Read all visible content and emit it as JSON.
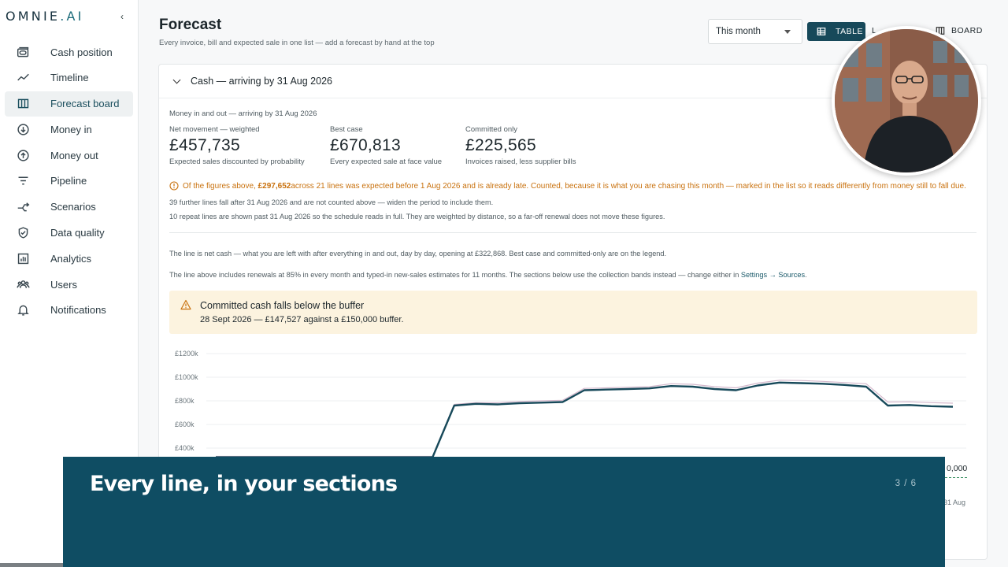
{
  "brand": {
    "name": "OMNIE",
    "dot": ".",
    "suffix": "AI"
  },
  "sidebar": {
    "collapse_glyph": "‹",
    "items": [
      {
        "label": "Cash position",
        "icon": "wallet-icon"
      },
      {
        "label": "Timeline",
        "icon": "trend-line-icon"
      },
      {
        "label": "Forecast board",
        "icon": "columns-icon",
        "active": true
      },
      {
        "label": "Money in",
        "icon": "arrow-down-circle-icon"
      },
      {
        "label": "Money out",
        "icon": "arrow-up-circle-icon"
      },
      {
        "label": "Pipeline",
        "icon": "filter-icon"
      },
      {
        "label": "Scenarios",
        "icon": "branch-arrows-icon"
      },
      {
        "label": "Data quality",
        "icon": "shield-check-icon"
      },
      {
        "label": "Analytics",
        "icon": "bar-chart-icon"
      },
      {
        "label": "Users",
        "icon": "users-icon"
      },
      {
        "label": "Notifications",
        "icon": "bell-icon"
      }
    ]
  },
  "header": {
    "title": "Forecast",
    "subtitle": "Every invoice, bill and expected sale in one list — add a forecast by hand at the top",
    "period": "This month",
    "views": {
      "table": "TABLE",
      "list": "L",
      "board": "BOARD"
    }
  },
  "section": {
    "title": "Cash — arriving by 31 Aug 2026",
    "label": "Money in and out — arriving by 31 Aug 2026",
    "metrics": [
      {
        "label": "Net movement — weighted",
        "value": "£457,735",
        "sub": "Expected sales discounted by probability"
      },
      {
        "label": "Best case",
        "value": "£670,813",
        "sub": "Every expected sale at face value"
      },
      {
        "label": "Committed only",
        "value": "£225,565",
        "sub": "Invoices raised, less supplier bills"
      }
    ],
    "late": {
      "prefix": "Of the figures above, ",
      "amount": "£297,652",
      "suffix": " across 21 lines was expected before 1 Aug 2026 and is already late. Counted, because it is what you are chasing this month — marked in the list so it reads differently from money still to fall due."
    },
    "note1": "39 further lines fall after 31 Aug 2026 and are not counted above — widen the period to include them.",
    "note2": "10 repeat lines are shown past 31 Aug 2026 so the schedule reads in full. They are weighted by distance, so a far-off renewal does not move these figures.",
    "explain1": "The line is net cash — what you are left with after everything in and out, day by day, opening at £322,868. Best case and committed-only are on the legend.",
    "explain2_prefix": "The line above includes renewals at 85% in every month and typed-in new-sales estimates for 11 months. The sections below use the collection bands instead — change either in ",
    "explain2_link": "Settings → Sources",
    "explain2_suffix": "."
  },
  "alert": {
    "title": "Committed cash falls below the buffer",
    "detail": "28 Sept 2026 — £147,527 against a £150,000 buffer."
  },
  "chart_data": {
    "type": "line",
    "y_ticks": [
      "£1200k",
      "£1000k",
      "£800k",
      "£600k",
      "£400k"
    ],
    "ylim": [
      0,
      1200000
    ],
    "series": [
      {
        "values": [
          322868,
          322868,
          322868,
          322868,
          322868,
          322868,
          322868,
          322868,
          322868,
          322868,
          322868,
          760000,
          775000,
          770000,
          780000,
          785000,
          790000,
          890000,
          895000,
          900000,
          905000,
          925000,
          920000,
          900000,
          890000,
          930000,
          955000,
          950000,
          945000,
          935000,
          920000,
          760000,
          765000,
          755000,
          750000
        ],
        "color": "#17495a"
      },
      {
        "values": [
          330000,
          330000,
          330000,
          330000,
          330000,
          330000,
          330000,
          330000,
          330000,
          330000,
          330000,
          770000,
          785000,
          785000,
          795000,
          800000,
          805000,
          905000,
          910000,
          915000,
          920000,
          945000,
          940000,
          920000,
          910000,
          950000,
          975000,
          972000,
          965000,
          955000,
          945000,
          790000,
          792000,
          785000,
          780000
        ],
        "color": "#d4b8cc"
      }
    ],
    "colors": {
      "primary": "#17495a",
      "best_case": "#d4b8cc",
      "buffer": "#2e8a5a"
    }
  },
  "peek": {
    "value_tail": "0,000",
    "date_tail": "31 Aug"
  },
  "banner": {
    "title": "Every line, in your sections",
    "counter": "3 / 6"
  }
}
